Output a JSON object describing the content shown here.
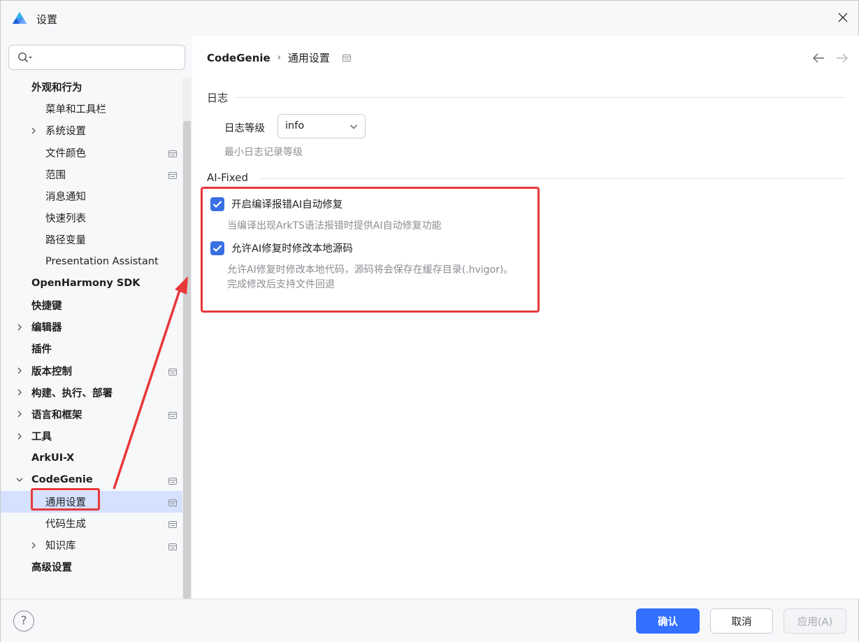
{
  "window": {
    "title": "设置"
  },
  "search": {
    "placeholder": "",
    "value": ""
  },
  "sidebar": {
    "items": [
      {
        "label": "外观和行为",
        "bold": true,
        "indent": 0,
        "chevron": "none",
        "project": false
      },
      {
        "label": "菜单和工具栏",
        "bold": false,
        "indent": 1,
        "chevron": "none",
        "project": false
      },
      {
        "label": "系统设置",
        "bold": false,
        "indent": 1,
        "chevron": "right",
        "project": false
      },
      {
        "label": "文件颜色",
        "bold": false,
        "indent": 1,
        "chevron": "none",
        "project": true
      },
      {
        "label": "范围",
        "bold": false,
        "indent": 1,
        "chevron": "none",
        "project": true
      },
      {
        "label": "消息通知",
        "bold": false,
        "indent": 1,
        "chevron": "none",
        "project": false
      },
      {
        "label": "快速列表",
        "bold": false,
        "indent": 1,
        "chevron": "none",
        "project": false
      },
      {
        "label": "路径变量",
        "bold": false,
        "indent": 1,
        "chevron": "none",
        "project": false
      },
      {
        "label": "Presentation Assistant",
        "bold": false,
        "indent": 1,
        "chevron": "none",
        "project": false
      },
      {
        "label": "OpenHarmony SDK",
        "bold": true,
        "indent": 0,
        "chevron": "none",
        "project": false
      },
      {
        "label": "快捷键",
        "bold": true,
        "indent": 0,
        "chevron": "none",
        "project": false
      },
      {
        "label": "编辑器",
        "bold": true,
        "indent": 0,
        "chevron": "right",
        "project": false
      },
      {
        "label": "插件",
        "bold": true,
        "indent": 0,
        "chevron": "none",
        "project": false
      },
      {
        "label": "版本控制",
        "bold": true,
        "indent": 0,
        "chevron": "right",
        "project": true
      },
      {
        "label": "构建、执行、部署",
        "bold": true,
        "indent": 0,
        "chevron": "right",
        "project": false
      },
      {
        "label": "语言和框架",
        "bold": true,
        "indent": 0,
        "chevron": "right",
        "project": true
      },
      {
        "label": "工具",
        "bold": true,
        "indent": 0,
        "chevron": "right",
        "project": false
      },
      {
        "label": "ArkUI-X",
        "bold": true,
        "indent": 0,
        "chevron": "none",
        "project": false
      },
      {
        "label": "CodeGenie",
        "bold": true,
        "indent": 0,
        "chevron": "down",
        "project": true
      },
      {
        "label": "通用设置",
        "bold": false,
        "indent": 1,
        "chevron": "none",
        "project": true,
        "selected": true
      },
      {
        "label": "代码生成",
        "bold": false,
        "indent": 1,
        "chevron": "none",
        "project": true
      },
      {
        "label": "知识库",
        "bold": false,
        "indent": 1,
        "chevron": "right",
        "project": true
      },
      {
        "label": "高级设置",
        "bold": true,
        "indent": 0,
        "chevron": "none",
        "project": false
      }
    ]
  },
  "breadcrumb": {
    "root": "CodeGenie",
    "separator": "›",
    "current": "通用设置"
  },
  "log_section": {
    "title": "日志",
    "level_label": "日志等级",
    "level_value": "info",
    "level_hint": "最小日志记录等级"
  },
  "ai_section": {
    "title": "AI-Fixed",
    "option1": {
      "label": "开启编译报错AI自动修复",
      "checked": true,
      "hint": "当编译出现ArkTS语法报错时提供AI自动修复功能"
    },
    "option2": {
      "label": "允许AI修复时修改本地源码",
      "checked": true,
      "hint_line1": "允许AI修复时修改本地代码，源码将会保存在缓存目录(.hvigor)。",
      "hint_line2": "完成修改后支持文件回退"
    }
  },
  "footer": {
    "help": "?",
    "ok": "确认",
    "cancel": "取消",
    "apply": "应用(A)"
  },
  "colors": {
    "accent": "#3370ff",
    "checkbox": "#3a6fe4",
    "selected_row": "#d5e1ff",
    "annotation_red": "#e8373a"
  }
}
